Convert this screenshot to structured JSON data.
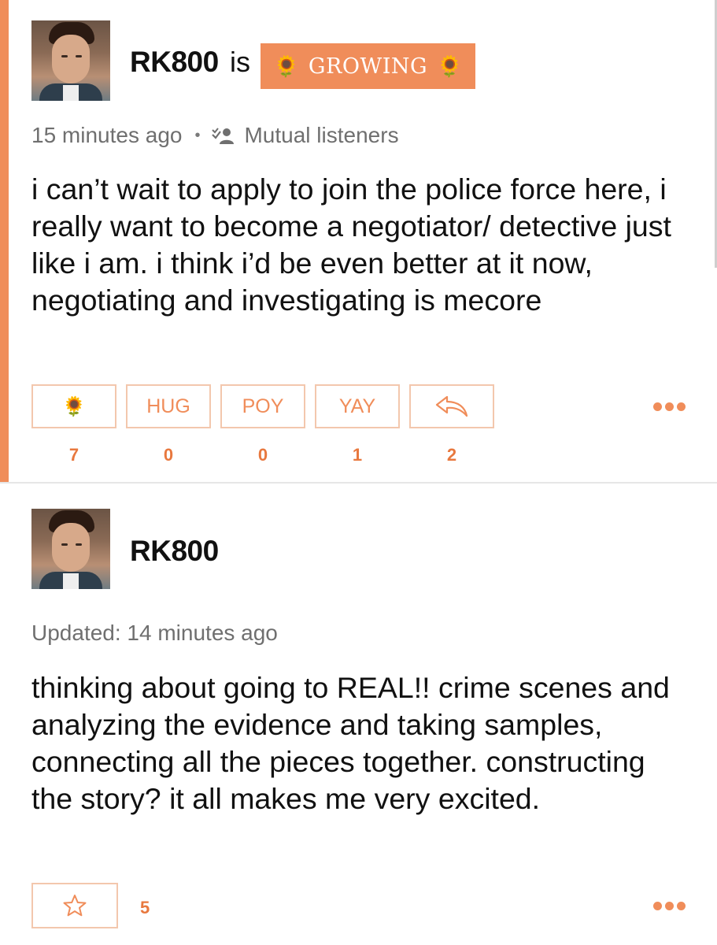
{
  "colors": {
    "accent": "#f08d5a",
    "count_text": "#e8783e",
    "muted": "#6f6f6f",
    "border": "#f3c7ad"
  },
  "post1": {
    "username": "RK800",
    "mood_prefix": "is",
    "mood": {
      "label": "GROWING",
      "icon": "sunflower-icon",
      "icon_glyph": "🌻"
    },
    "timestamp": "15 minutes ago",
    "separator": "•",
    "audience": "Mutual listeners",
    "text": "i can’t wait to apply to join the police force here, i really want to become a negotiator/ detective just like i am. i think i’d be even better at it now, negotiating and investigating is mecore",
    "reactions": [
      {
        "name": "sunflower",
        "label": "🌻",
        "count": "7"
      },
      {
        "name": "hug",
        "label": "HUG",
        "count": "0"
      },
      {
        "name": "poy",
        "label": "POY",
        "count": "0"
      },
      {
        "name": "yay",
        "label": "YAY",
        "count": "1"
      },
      {
        "name": "reply",
        "label": "",
        "icon": "reply-arrow-icon",
        "count": "2"
      }
    ]
  },
  "post2": {
    "username": "RK800",
    "updated": "Updated: 14 minutes ago",
    "text": "thinking about going to REAL!! crime scenes and analyzing the evidence and taking samples, connecting all the pieces together. constructing the story? it all makes me very excited.",
    "star_count": "5",
    "star_icon": "star-outline-icon"
  }
}
